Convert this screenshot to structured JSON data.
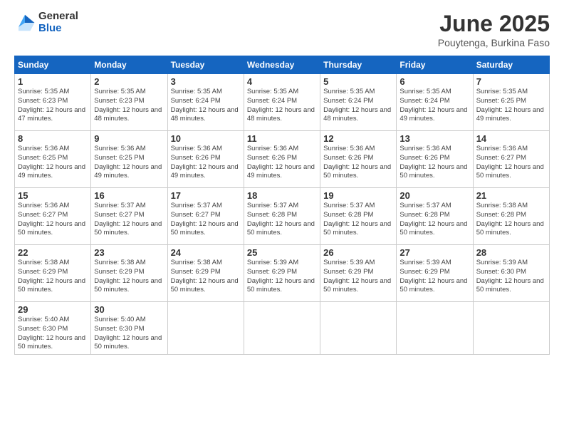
{
  "header": {
    "logo_general": "General",
    "logo_blue": "Blue",
    "month_title": "June 2025",
    "location": "Pouytenga, Burkina Faso"
  },
  "weekdays": [
    "Sunday",
    "Monday",
    "Tuesday",
    "Wednesday",
    "Thursday",
    "Friday",
    "Saturday"
  ],
  "weeks": [
    [
      {
        "day": "1",
        "sunrise": "5:35 AM",
        "sunset": "6:23 PM",
        "daylight": "12 hours and 47 minutes."
      },
      {
        "day": "2",
        "sunrise": "5:35 AM",
        "sunset": "6:23 PM",
        "daylight": "12 hours and 48 minutes."
      },
      {
        "day": "3",
        "sunrise": "5:35 AM",
        "sunset": "6:24 PM",
        "daylight": "12 hours and 48 minutes."
      },
      {
        "day": "4",
        "sunrise": "5:35 AM",
        "sunset": "6:24 PM",
        "daylight": "12 hours and 48 minutes."
      },
      {
        "day": "5",
        "sunrise": "5:35 AM",
        "sunset": "6:24 PM",
        "daylight": "12 hours and 48 minutes."
      },
      {
        "day": "6",
        "sunrise": "5:35 AM",
        "sunset": "6:24 PM",
        "daylight": "12 hours and 49 minutes."
      },
      {
        "day": "7",
        "sunrise": "5:35 AM",
        "sunset": "6:25 PM",
        "daylight": "12 hours and 49 minutes."
      }
    ],
    [
      {
        "day": "8",
        "sunrise": "5:36 AM",
        "sunset": "6:25 PM",
        "daylight": "12 hours and 49 minutes."
      },
      {
        "day": "9",
        "sunrise": "5:36 AM",
        "sunset": "6:25 PM",
        "daylight": "12 hours and 49 minutes."
      },
      {
        "day": "10",
        "sunrise": "5:36 AM",
        "sunset": "6:26 PM",
        "daylight": "12 hours and 49 minutes."
      },
      {
        "day": "11",
        "sunrise": "5:36 AM",
        "sunset": "6:26 PM",
        "daylight": "12 hours and 49 minutes."
      },
      {
        "day": "12",
        "sunrise": "5:36 AM",
        "sunset": "6:26 PM",
        "daylight": "12 hours and 50 minutes."
      },
      {
        "day": "13",
        "sunrise": "5:36 AM",
        "sunset": "6:26 PM",
        "daylight": "12 hours and 50 minutes."
      },
      {
        "day": "14",
        "sunrise": "5:36 AM",
        "sunset": "6:27 PM",
        "daylight": "12 hours and 50 minutes."
      }
    ],
    [
      {
        "day": "15",
        "sunrise": "5:36 AM",
        "sunset": "6:27 PM",
        "daylight": "12 hours and 50 minutes."
      },
      {
        "day": "16",
        "sunrise": "5:37 AM",
        "sunset": "6:27 PM",
        "daylight": "12 hours and 50 minutes."
      },
      {
        "day": "17",
        "sunrise": "5:37 AM",
        "sunset": "6:27 PM",
        "daylight": "12 hours and 50 minutes."
      },
      {
        "day": "18",
        "sunrise": "5:37 AM",
        "sunset": "6:28 PM",
        "daylight": "12 hours and 50 minutes."
      },
      {
        "day": "19",
        "sunrise": "5:37 AM",
        "sunset": "6:28 PM",
        "daylight": "12 hours and 50 minutes."
      },
      {
        "day": "20",
        "sunrise": "5:37 AM",
        "sunset": "6:28 PM",
        "daylight": "12 hours and 50 minutes."
      },
      {
        "day": "21",
        "sunrise": "5:38 AM",
        "sunset": "6:28 PM",
        "daylight": "12 hours and 50 minutes."
      }
    ],
    [
      {
        "day": "22",
        "sunrise": "5:38 AM",
        "sunset": "6:29 PM",
        "daylight": "12 hours and 50 minutes."
      },
      {
        "day": "23",
        "sunrise": "5:38 AM",
        "sunset": "6:29 PM",
        "daylight": "12 hours and 50 minutes."
      },
      {
        "day": "24",
        "sunrise": "5:38 AM",
        "sunset": "6:29 PM",
        "daylight": "12 hours and 50 minutes."
      },
      {
        "day": "25",
        "sunrise": "5:39 AM",
        "sunset": "6:29 PM",
        "daylight": "12 hours and 50 minutes."
      },
      {
        "day": "26",
        "sunrise": "5:39 AM",
        "sunset": "6:29 PM",
        "daylight": "12 hours and 50 minutes."
      },
      {
        "day": "27",
        "sunrise": "5:39 AM",
        "sunset": "6:29 PM",
        "daylight": "12 hours and 50 minutes."
      },
      {
        "day": "28",
        "sunrise": "5:39 AM",
        "sunset": "6:30 PM",
        "daylight": "12 hours and 50 minutes."
      }
    ],
    [
      {
        "day": "29",
        "sunrise": "5:40 AM",
        "sunset": "6:30 PM",
        "daylight": "12 hours and 50 minutes."
      },
      {
        "day": "30",
        "sunrise": "5:40 AM",
        "sunset": "6:30 PM",
        "daylight": "12 hours and 50 minutes."
      },
      null,
      null,
      null,
      null,
      null
    ]
  ],
  "labels": {
    "sunrise_prefix": "Sunrise: ",
    "sunset_prefix": "Sunset: ",
    "daylight_prefix": "Daylight: "
  }
}
